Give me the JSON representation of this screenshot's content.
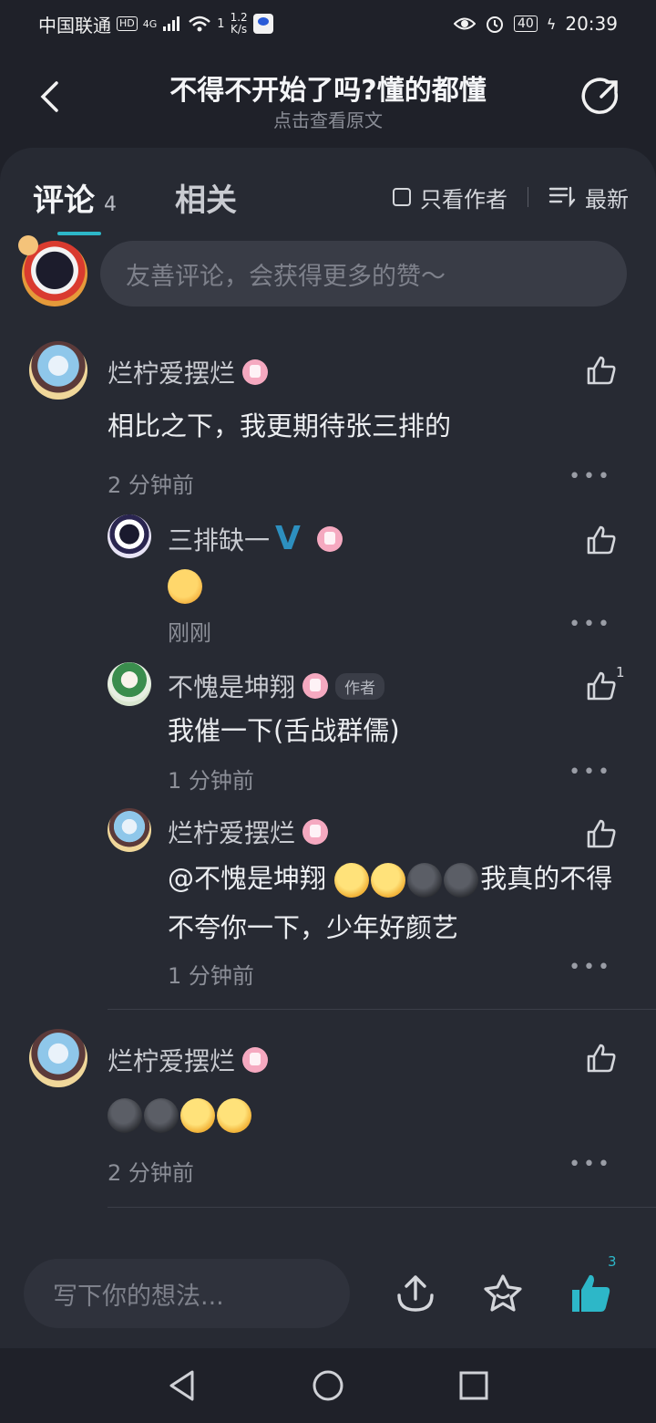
{
  "status_bar": {
    "carrier": "中国联通",
    "hd_badge": "HD",
    "network": "4G",
    "wifi_sub": "1",
    "speed_value": "1.2",
    "speed_unit": "K/s",
    "battery": "40",
    "time": "20:39"
  },
  "header": {
    "title": "不得不开始了吗?懂的都懂",
    "subtitle": "点击查看原文"
  },
  "tabs": {
    "comments_label": "评论",
    "comments_count": "4",
    "related_label": "相关",
    "author_only_label": "只看作者",
    "sort_label": "最新"
  },
  "comment_input": {
    "placeholder": "友善评论，会获得更多的赞～"
  },
  "comments": [
    {
      "name": "烂柠爱摆烂",
      "text": "相比之下，我更期待张三排的",
      "time": "2 分钟前",
      "replies": [
        {
          "name": "三排缺一",
          "verified": "V",
          "emoji": "flushed-face",
          "time": "刚刚"
        },
        {
          "name": "不愧是坤翔",
          "author_tag": "作者",
          "text": "我催一下(舌战群儒)",
          "time": "1 分钟前",
          "likes": "1"
        },
        {
          "name": "烂柠爱摆烂",
          "mention": "@不愧是坤翔",
          "text": "我真的不得不夸你一下，少年好颜艺",
          "time": "1 分钟前"
        }
      ]
    },
    {
      "name": "烂柠爱摆烂",
      "emoji": "dark-moon-face,dark-moon-face,smirk-face,smirk-face",
      "time": "2 分钟前"
    }
  ],
  "bottom_bar": {
    "placeholder": "写下你的想法...",
    "like_count": "3"
  },
  "colors": {
    "accent": "#2db7c8",
    "background": "#1f2129",
    "sheet": "#272a33"
  }
}
